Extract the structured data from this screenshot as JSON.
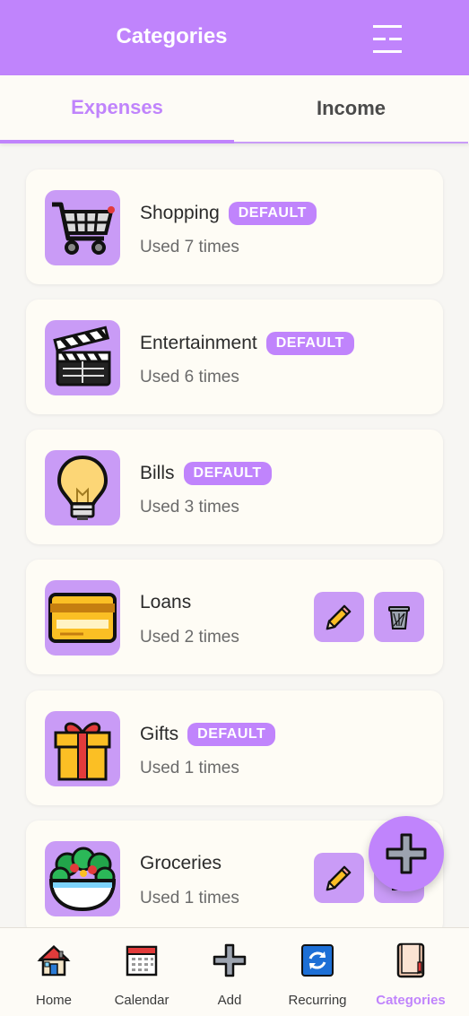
{
  "header": {
    "title": "Categories",
    "menu_icon": "menu-icon"
  },
  "tabs": [
    {
      "label": "Expenses",
      "active": true
    },
    {
      "label": "Income",
      "active": false
    }
  ],
  "categories": [
    {
      "name": "Shopping",
      "usage": "Used 7 times",
      "badge": "DEFAULT",
      "icon": "shopping-cart-icon"
    },
    {
      "name": "Entertainment",
      "usage": "Used 6 times",
      "badge": "DEFAULT",
      "icon": "clapperboard-icon"
    },
    {
      "name": "Bills",
      "usage": "Used 3 times",
      "badge": "DEFAULT",
      "icon": "lightbulb-icon"
    },
    {
      "name": "Loans",
      "usage": "Used 2 times",
      "badge": "",
      "icon": "credit-card-icon"
    },
    {
      "name": "Gifts",
      "usage": "Used 1 times",
      "badge": "DEFAULT",
      "icon": "gift-icon"
    },
    {
      "name": "Groceries",
      "usage": "Used 1 times",
      "badge": "",
      "icon": "salad-icon"
    }
  ],
  "nav": [
    {
      "label": "Home",
      "icon": "home-icon",
      "active": false
    },
    {
      "label": "Calendar",
      "icon": "calendar-icon",
      "active": false
    },
    {
      "label": "Add",
      "icon": "plus-icon",
      "active": false
    },
    {
      "label": "Recurring",
      "icon": "recurring-icon",
      "active": false
    },
    {
      "label": "Categories",
      "icon": "notebook-icon",
      "active": true
    }
  ],
  "colors": {
    "accent": "#c084fc",
    "icon_bg": "#c99bf6",
    "card_bg": "#fefcf5",
    "page_bg": "#f7f6f3"
  }
}
